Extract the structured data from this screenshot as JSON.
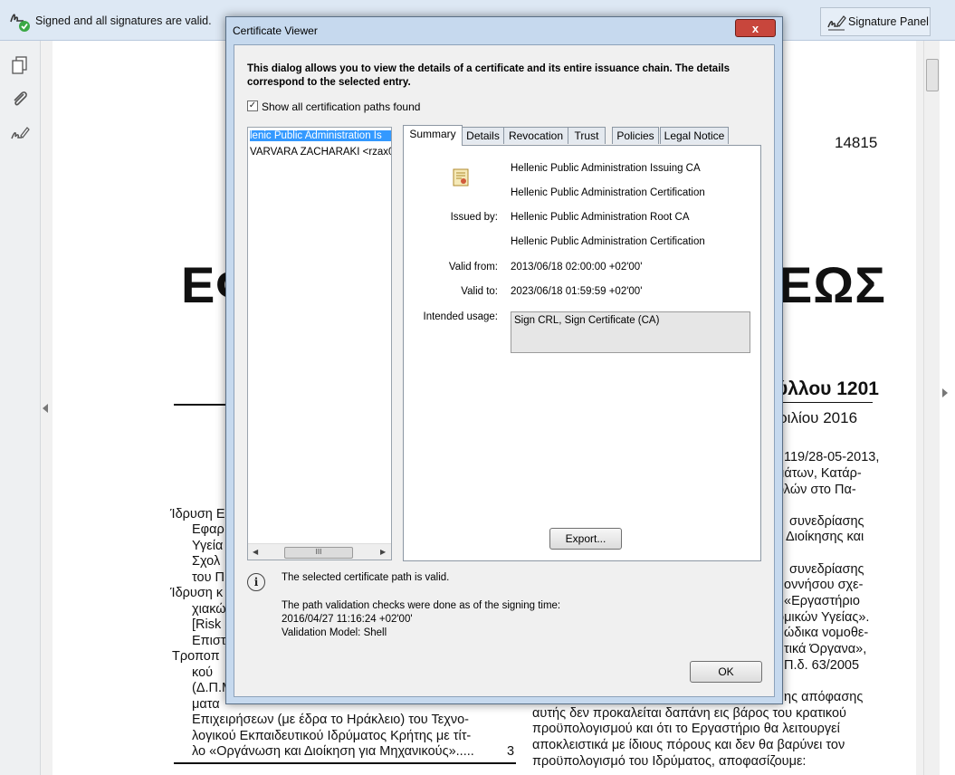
{
  "topbar": {
    "signature_status": "Signed and all signatures are valid.",
    "signature_panel_label": "Signature Panel"
  },
  "document": {
    "page_number": "14815",
    "headline_left": "ΕΦ",
    "headline_right": "ΕΩΣ",
    "issue_title": "ύλλου 1201",
    "issue_date": "ριλίου 2016",
    "right_column": [
      "119/28-05-2013,",
      "μάτων, Κατάρ-",
      "ολών στο Πα-",
      "συνεδρίασης",
      "Διοίκησης και",
      "συνεδρίασης",
      "οννήσου σχε-",
      "«Εργαστήριο",
      "ομικών Υγείας».",
      "ώδικα νομοθε-",
      "τικά Όργανα»,",
      "Π.δ. 63/2005",
      "ης απόφασης",
      "αυτής δεν προκαλείται δαπάνη εις βάρος του κρατικού",
      "προϋπολογισμού και ότι το Εργαστήριο θα λειτουργεί",
      "αποκλειστικά με ίδιους πόρους και δεν θα βαρύνει τον",
      "προϋπολογισμό του Ιδρύματος, αποφασίζουμε:"
    ],
    "left_column": [
      "Ίδρυση Ε",
      "Εφαρ",
      "Υγεία",
      "Σχολ",
      "του Π",
      "Ίδρυση κ",
      "χιακώ",
      "[Risk",
      "Επιστ",
      "Τροποπ",
      "κού",
      "(Δ.Π.Μ",
      "ματα",
      "Επιχειρήσεων (με έδρα το Ηράκλειο) του Τεχνο-",
      "λογικού Εκπαιδευτικού Ιδρύματος Κρήτης με τίτ-",
      "λο «Οργάνωση και Διοίκηση για Μηχανικούς».....",
      "3"
    ]
  },
  "dialog": {
    "title": "Certificate Viewer",
    "close_label": "x",
    "intro": "This dialog allows you to view the details of a certificate and its entire issuance chain. The details correspond to the selected entry.",
    "show_paths_label": "Show all certification paths found",
    "show_paths_checked": true,
    "tree_items": [
      "lenic Public Administration Is",
      "VARVARA ZACHARAKI <rzax0"
    ],
    "tabs": [
      "Summary",
      "Details",
      "Revocation",
      "Trust",
      "Policies",
      "Legal Notice"
    ],
    "active_tab": "Summary",
    "summary": {
      "subject_line1": "Hellenic Public Administration Issuing CA",
      "subject_line2": "Hellenic Public Administration Certification",
      "issued_by_label": "Issued by:",
      "issued_by_line1": "Hellenic Public Administration Root CA",
      "issued_by_line2": "Hellenic Public Administration Certification",
      "valid_from_label": "Valid from:",
      "valid_from": "2013/06/18 02:00:00 +02'00'",
      "valid_to_label": "Valid to:",
      "valid_to": "2023/06/18 01:59:59 +02'00'",
      "intended_usage_label": "Intended usage:",
      "intended_usage": "Sign CRL, Sign Certificate (CA)"
    },
    "export_label": "Export...",
    "status_valid": "The selected certificate path is valid.",
    "status_checks": "The path validation checks were done as of the signing time:",
    "status_time": "2016/04/27 11:16:24 +02'00'",
    "status_model": "Validation Model: Shell",
    "ok_label": "OK"
  },
  "icons": {
    "signature_status": "signature-valid-icon",
    "signature_panel": "signature-pen-icon",
    "pages": "pages-icon",
    "attachments": "paperclip-icon",
    "signatures": "signature-pen-icon",
    "certificate": "certificate-icon",
    "info": "info-icon"
  },
  "colors": {
    "valid_check": "#3aa845",
    "selection": "#3399ff",
    "close_button": "#c8463c"
  }
}
